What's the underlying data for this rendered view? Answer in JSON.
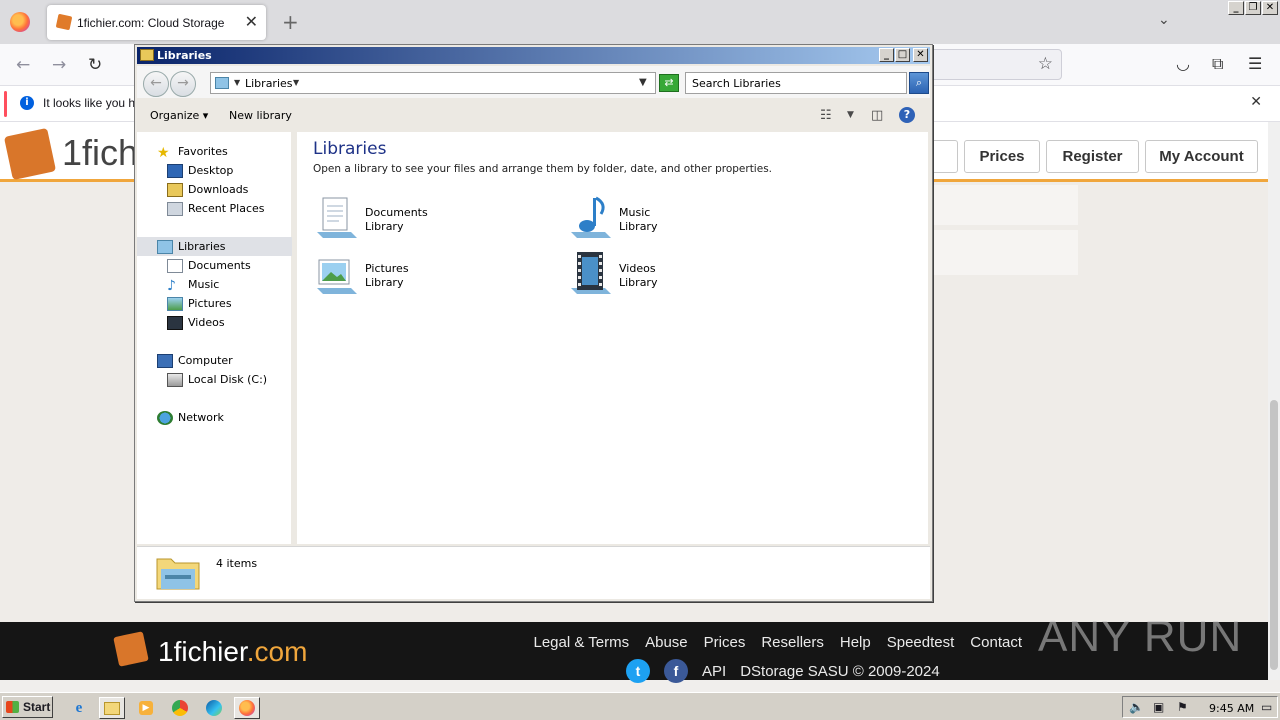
{
  "browser": {
    "tab_title": "1fichier.com: Cloud Storage",
    "notification_text": "It looks like you ha"
  },
  "site": {
    "logo_text": "1fich",
    "nav_buttons": [
      "Prices",
      "Register",
      "My Account"
    ],
    "footer": {
      "logo_main": "1fichier",
      "logo_suffix": ".com",
      "links": [
        "Legal & Terms",
        "Abuse",
        "Prices",
        "Resellers",
        "Help",
        "Speedtest",
        "Contact"
      ],
      "api": "API",
      "copyright": "DStorage SASU © 2009-2024"
    },
    "watermark": "ANY RUN"
  },
  "explorer": {
    "title": "Libraries",
    "address": "Libraries",
    "search_placeholder": "Search Libraries",
    "commands": {
      "organize": "Organize",
      "new_library": "New library"
    },
    "nav": {
      "favorites": "Favorites",
      "favorites_items": [
        "Desktop",
        "Downloads",
        "Recent Places"
      ],
      "libraries": "Libraries",
      "libraries_items": [
        "Documents",
        "Music",
        "Pictures",
        "Videos"
      ],
      "computer": "Computer",
      "computer_items": [
        "Local Disk (C:)"
      ],
      "network": "Network"
    },
    "content": {
      "heading": "Libraries",
      "subtitle": "Open a library to see your files and arrange them by folder, date, and other properties.",
      "libraries": [
        {
          "name": "Documents",
          "type": "Library",
          "icon": "documents-library-icon"
        },
        {
          "name": "Music",
          "type": "Library",
          "icon": "music-library-icon"
        },
        {
          "name": "Pictures",
          "type": "Library",
          "icon": "pictures-library-icon"
        },
        {
          "name": "Videos",
          "type": "Library",
          "icon": "videos-library-icon"
        }
      ]
    },
    "status": "4 items"
  },
  "taskbar": {
    "start": "Start",
    "clock": "9:45 AM"
  }
}
